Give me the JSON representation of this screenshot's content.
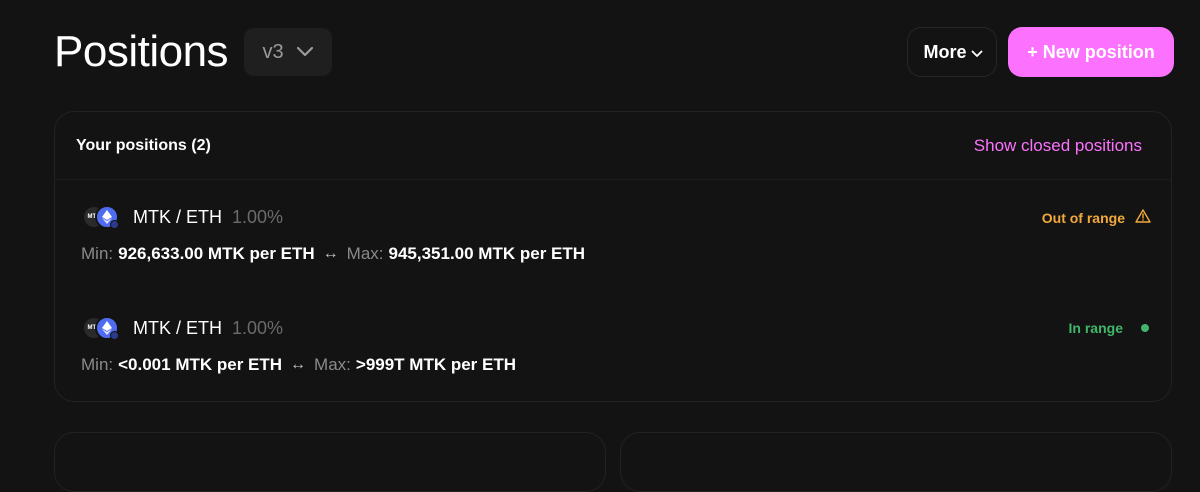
{
  "header": {
    "title": "Positions",
    "version": "v3",
    "more_label": "More",
    "new_position_label": "+ New position"
  },
  "positions_card": {
    "title": "Your positions (2)",
    "show_closed_label": "Show closed positions"
  },
  "positions": [
    {
      "token0_symbol": "MTK",
      "pair": "MTK / ETH",
      "fee": "1.00%",
      "min_label": "Min:",
      "min_value": "926,633.00 MTK per ETH",
      "arrow": "↔",
      "max_label": "Max:",
      "max_value": "945,351.00 MTK per ETH",
      "status": "Out of range",
      "status_color": "#f2a93b"
    },
    {
      "token0_symbol": "MTK",
      "pair": "MTK / ETH",
      "fee": "1.00%",
      "min_label": "Min:",
      "min_value": "<0.001 MTK per ETH",
      "arrow": "↔",
      "max_label": "Max:",
      "max_value": ">999T MTK per ETH",
      "status": "In range",
      "status_color": "#40b66b"
    }
  ],
  "colors": {
    "accent": "#fc72ff",
    "background": "#131313",
    "eth_blue": "#4f6cf0"
  },
  "icons": {
    "version_dropdown": "chevron-down-icon",
    "more_dropdown": "chevron-down-icon",
    "out_of_range": "warning-triangle-icon",
    "in_range": "status-dot-icon"
  }
}
